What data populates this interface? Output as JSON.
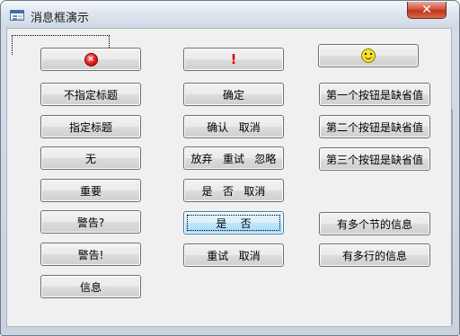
{
  "window": {
    "title": "消息框演示",
    "close_label": "✕"
  },
  "buttons": {
    "critical_icon_btn": "×",
    "exclamation_icon_btn": "!",
    "smile_icon_btn": "",
    "no_title": "不指定标题",
    "ok": "确定",
    "first_default": "第一个按钮是缺省值",
    "with_title": "指定标题",
    "ok_cancel": "确认   取消",
    "second_default": "第二个按钮是缺省值",
    "none": "无",
    "abort_retry_ignore": "放弃   重试   忽略",
    "third_default": "第三个按钮是缺省值",
    "important": "重要",
    "yes_no_cancel": "是   否   取消",
    "warning_q": "警告?",
    "yes_no": "是    否",
    "multi_section": "有多个节的信息",
    "warning_excl": "警告!",
    "retry_cancel": "重试   取消",
    "multi_line": "有多行的信息",
    "info": "信息"
  },
  "icons": {
    "critical": "error-icon",
    "exclamation": "exclamation-icon",
    "smile": "smiley-icon",
    "app": "form-icon"
  }
}
